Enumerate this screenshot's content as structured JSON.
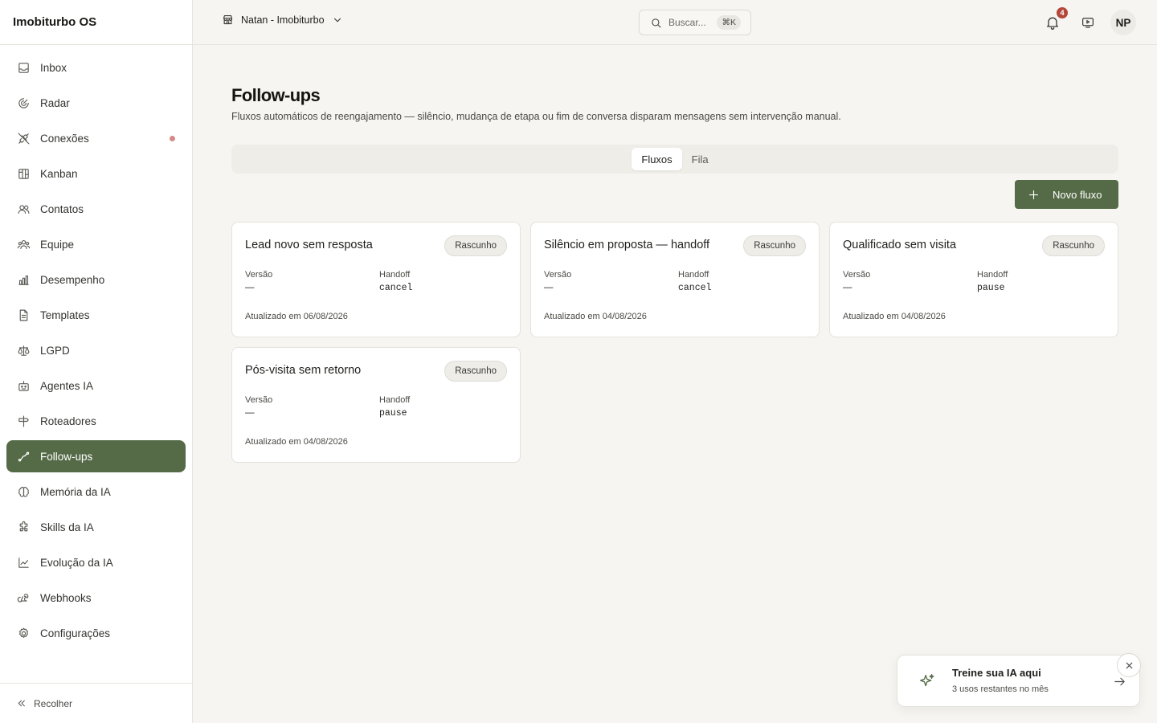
{
  "app": {
    "title": "Imobiturbo OS"
  },
  "sidebar": {
    "items": [
      {
        "label": "Inbox",
        "icon": "inbox-icon"
      },
      {
        "label": "Radar",
        "icon": "radar-icon"
      },
      {
        "label": "Conexões",
        "icon": "plug-off-icon",
        "indicator": "status-dot"
      },
      {
        "label": "Kanban",
        "icon": "kanban-icon"
      },
      {
        "label": "Contatos",
        "icon": "contacts-icon"
      },
      {
        "label": "Equipe",
        "icon": "team-icon"
      },
      {
        "label": "Desempenho",
        "icon": "bar-chart-icon"
      },
      {
        "label": "Templates",
        "icon": "document-icon"
      },
      {
        "label": "LGPD",
        "icon": "scale-icon"
      },
      {
        "label": "Agentes IA",
        "icon": "bot-icon"
      },
      {
        "label": "Roteadores",
        "icon": "signpost-icon"
      },
      {
        "label": "Follow-ups",
        "icon": "trend-path-icon",
        "active": true
      },
      {
        "label": "Memória da IA",
        "icon": "brain-icon"
      },
      {
        "label": "Skills da IA",
        "icon": "puzzle-icon"
      },
      {
        "label": "Evolução da IA",
        "icon": "line-chart-icon"
      },
      {
        "label": "Webhooks",
        "icon": "webhook-icon"
      },
      {
        "label": "Configurações",
        "icon": "gear-icon"
      }
    ],
    "collapse_label": "Recolher"
  },
  "topbar": {
    "workspace": "Natan - Imobiturbo",
    "search_placeholder": "Buscar...",
    "search_shortcut": "⌘K",
    "notifications_count": "4",
    "avatar_initials": "NP"
  },
  "page": {
    "title": "Follow-ups",
    "subtitle": "Fluxos automáticos de reengajamento — silêncio, mudança de etapa ou fim de conversa disparam mensagens sem intervenção manual.",
    "tabs": [
      {
        "label": "Fluxos",
        "active": true
      },
      {
        "label": "Fila",
        "active": false
      }
    ],
    "new_button": "Novo fluxo",
    "version_label": "Versão",
    "handoff_label": "Handoff"
  },
  "flows": [
    {
      "title": "Lead novo sem resposta",
      "status": "Rascunho",
      "version": "—",
      "handoff": "cancel",
      "updated": "Atualizado em 06/08/2026"
    },
    {
      "title": "Silêncio em proposta — handoff",
      "status": "Rascunho",
      "version": "—",
      "handoff": "cancel",
      "updated": "Atualizado em 04/08/2026"
    },
    {
      "title": "Qualificado sem visita",
      "status": "Rascunho",
      "version": "—",
      "handoff": "pause",
      "updated": "Atualizado em 04/08/2026"
    },
    {
      "title": "Pós-visita sem retorno",
      "status": "Rascunho",
      "version": "—",
      "handoff": "pause",
      "updated": "Atualizado em 04/08/2026"
    }
  ],
  "toast": {
    "title": "Treine sua IA aqui",
    "subtitle": "3 usos restantes no mês"
  },
  "colors": {
    "accent": "#556b47",
    "background": "#f6f5f1",
    "notification_badge": "#b3473a",
    "status_dot": "#d48a86"
  }
}
